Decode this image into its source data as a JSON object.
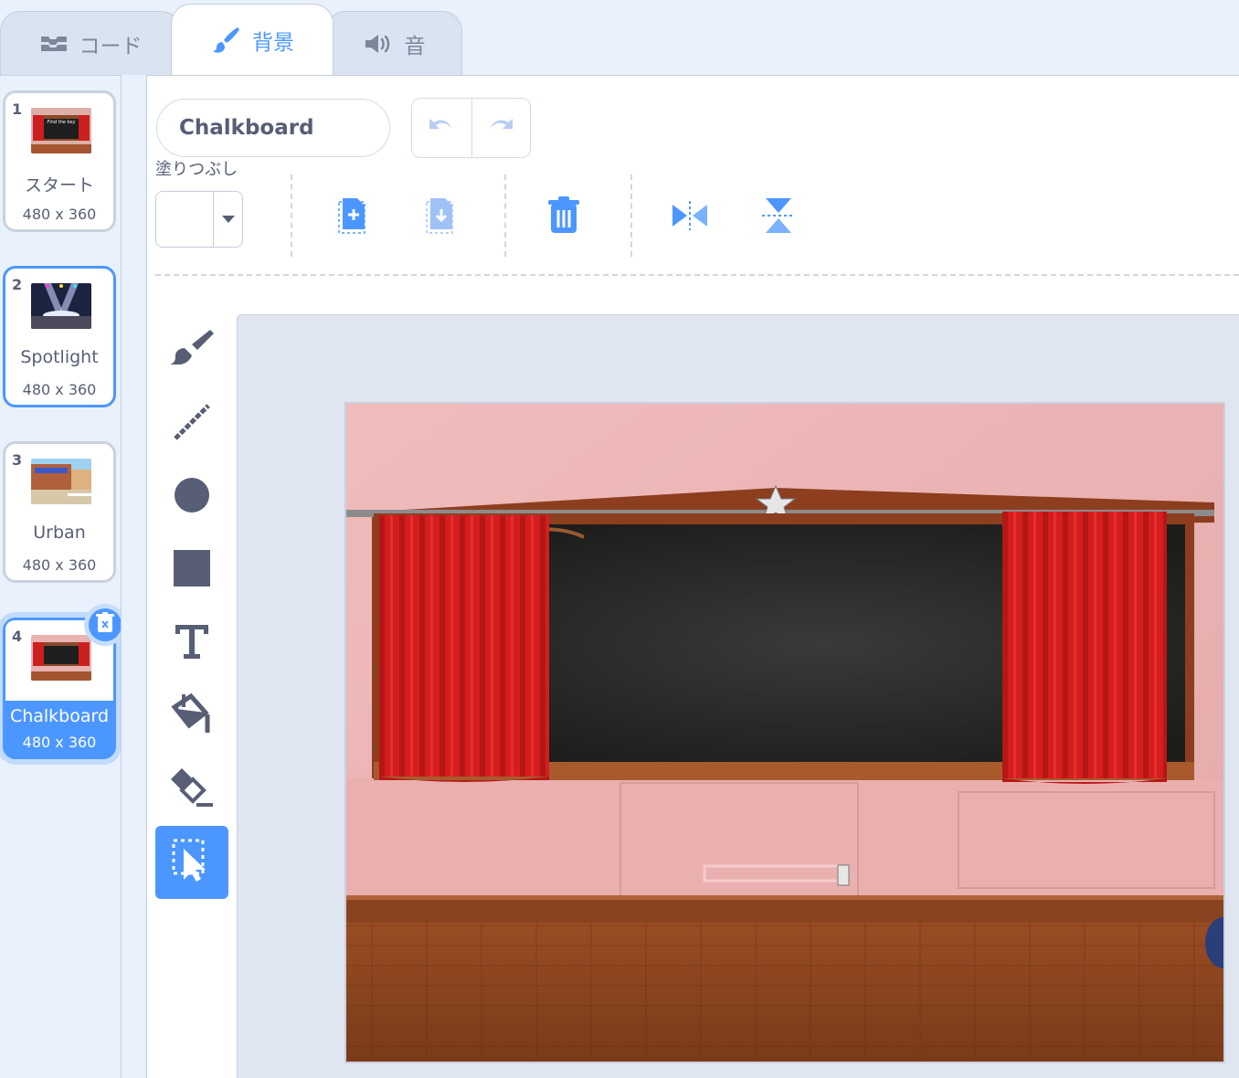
{
  "tabs": [
    {
      "label": "コード",
      "icon": "code-icon"
    },
    {
      "label": "背景",
      "icon": "brush-icon",
      "active": true
    },
    {
      "label": "音",
      "icon": "speaker-icon"
    }
  ],
  "backdrops": [
    {
      "number": "1",
      "name": "スタート",
      "size": "480 x 360",
      "thumb_caption": "Find the key"
    },
    {
      "number": "2",
      "name": "Spotlight",
      "size": "480 x 360"
    },
    {
      "number": "3",
      "name": "Urban",
      "size": "480 x 360"
    },
    {
      "number": "4",
      "name": "Chalkboard",
      "size": "480 x 360",
      "active": true
    }
  ],
  "editor": {
    "costume_name": "Chalkboard",
    "fill_label": "塗りつぶし",
    "fill_color": "#ffffff"
  },
  "colors": {
    "accent": "#4c97ff",
    "tab_inactive": "#d9e3f2",
    "panel_bg": "#e9f1fc",
    "text": "#575e75"
  }
}
